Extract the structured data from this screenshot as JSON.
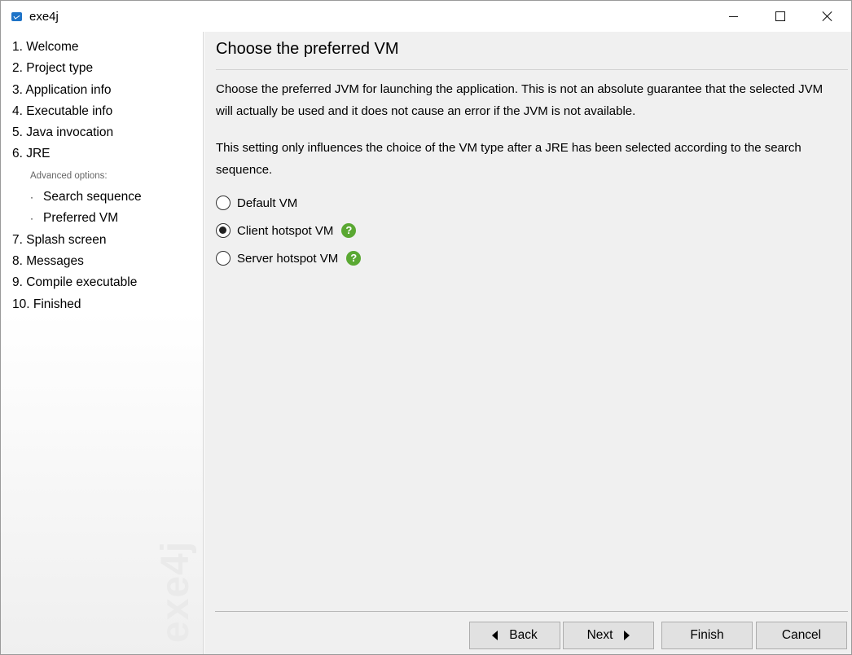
{
  "window": {
    "title": "exe4j"
  },
  "sidebar": {
    "items": [
      {
        "label": "1. Welcome"
      },
      {
        "label": "2. Project type"
      },
      {
        "label": "3. Application info"
      },
      {
        "label": "4. Executable info"
      },
      {
        "label": "5. Java invocation"
      },
      {
        "label": "6. JRE"
      }
    ],
    "advanced_heading": "Advanced options:",
    "sub_items": [
      {
        "bullet": "·",
        "label": "Search sequence"
      },
      {
        "bullet": "·",
        "label": "Preferred VM"
      }
    ],
    "items_after": [
      {
        "label": "7. Splash screen"
      },
      {
        "label": "8. Messages"
      },
      {
        "label": "9. Compile executable"
      },
      {
        "label": "10. Finished"
      }
    ],
    "watermark": "exe4j"
  },
  "main": {
    "title": "Choose the preferred VM",
    "description_1": "Choose the preferred JVM for launching the application. This is not an absolute guarantee that the selected JVM will actually be used and it does not cause an error if the JVM is not available.",
    "description_2": "This setting only influences the choice of the VM type after a JRE has been selected according to the search sequence.",
    "options": [
      {
        "label": "Default VM",
        "checked": false,
        "help": false
      },
      {
        "label": "Client hotspot VM",
        "checked": true,
        "help": true
      },
      {
        "label": "Server hotspot VM",
        "checked": false,
        "help": true
      }
    ],
    "help_glyph": "?"
  },
  "buttons": {
    "back": "Back",
    "next": "Next",
    "finish": "Finish",
    "cancel": "Cancel"
  },
  "colors": {
    "help_icon": "#5aa832",
    "panel_bg": "#f0f0f0",
    "button_bg": "#e1e1e1"
  }
}
